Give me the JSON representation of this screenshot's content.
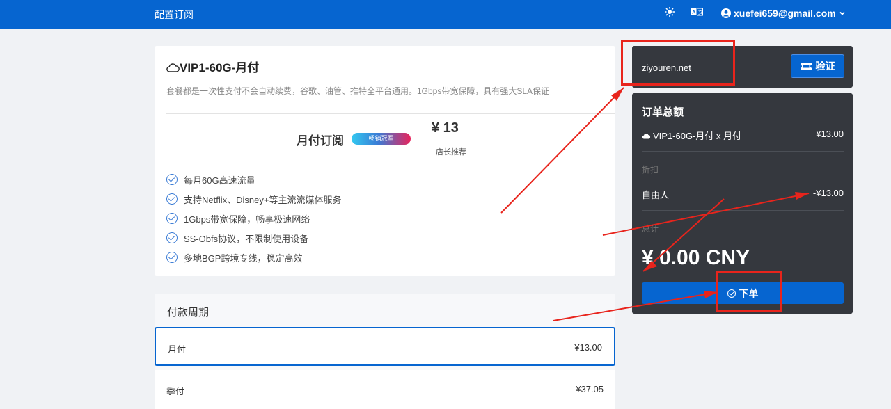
{
  "header": {
    "title": "配置订阅",
    "theme_icon": "sun-icon",
    "lang_icon": "translate-icon",
    "user_email": "xuefei659@gmail.com"
  },
  "plan": {
    "title": "VIP1-60G-月付",
    "description": "套餐都是一次性支付不会自动续费，谷歌、油管、推特全平台通用。1Gbps带宽保障，具有强大SLA保证",
    "subscription_label": "月付订阅",
    "badge": "畅销冠军",
    "price": "¥ 13",
    "price_note": "店长推荐",
    "features": [
      "每月60G高速流量",
      "支持Netflix、Disney+等主流流媒体服务",
      "1Gbps带宽保障，畅享极速网络",
      "SS-Obfs协议，不限制使用设备",
      "多地BGP跨境专线，稳定高效"
    ]
  },
  "period": {
    "heading": "付款周期",
    "options": [
      {
        "name": "月付",
        "price": "¥13.00"
      },
      {
        "name": "季付",
        "price": "¥37.05"
      }
    ]
  },
  "coupon": {
    "value": "ziyouren.net",
    "verify_label": "验证"
  },
  "summary": {
    "title": "订单总额",
    "item_name": "VIP1-60G-月付 x 月付",
    "item_price": "¥13.00",
    "discount_label": "折扣",
    "discount_name": "自由人",
    "discount_amount": "-¥13.00",
    "total_label": "总计",
    "total": "¥ 0.00 CNY",
    "order_label": "下单"
  },
  "colors": {
    "brand": "#0665d0",
    "dark_panel": "#35383e",
    "annotation_red": "#e8241c"
  }
}
